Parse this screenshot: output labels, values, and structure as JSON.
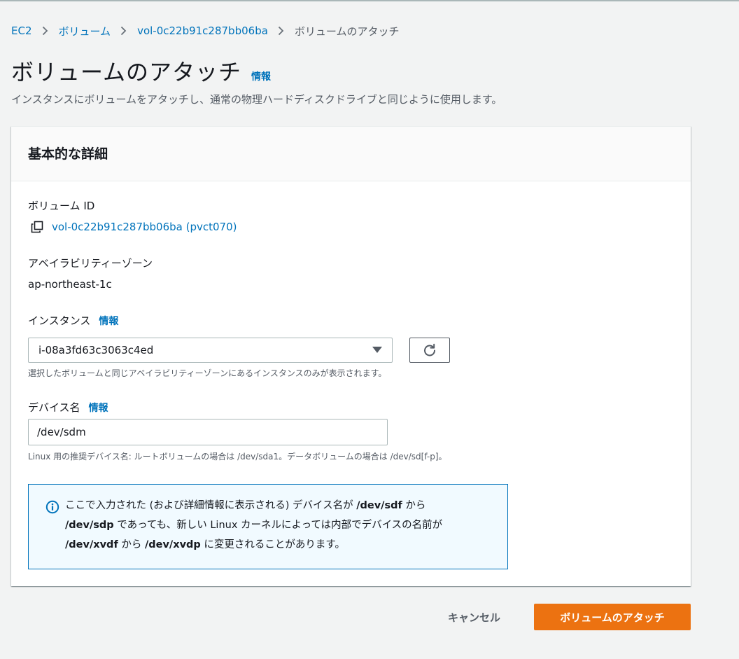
{
  "breadcrumb": {
    "items": [
      "EC2",
      "ボリューム",
      "vol-0c22b91c287bb06ba"
    ],
    "current": "ボリュームのアタッチ"
  },
  "header": {
    "title": "ボリュームのアタッチ",
    "info": "情報",
    "description": "インスタンスにボリュームをアタッチし、通常の物理ハードディスクドライブと同じように使用します。"
  },
  "card": {
    "title": "基本的な詳細",
    "volume_id": {
      "label": "ボリューム ID",
      "value": "vol-0c22b91c287bb06ba (pvct070)"
    },
    "availability_zone": {
      "label": "アベイラビリティーゾーン",
      "value": "ap-northeast-1c"
    },
    "instance": {
      "label": "インスタンス",
      "info": "情報",
      "selected": "i-08a3fd63c3063c4ed",
      "hint": "選択したボリュームと同じアベイラビリティーゾーンにあるインスタンスのみが表示されます。"
    },
    "device": {
      "label": "デバイス名",
      "info": "情報",
      "value": "/dev/sdm",
      "hint": "Linux 用の推奨デバイス名: ルートボリュームの場合は /dev/sda1。データボリュームの場合は /dev/sd[f-p]。"
    },
    "alert": {
      "t1": "ここで入力された (および詳細情報に表示される) デバイス名が ",
      "b1": "/dev/sdf",
      "t2": " から ",
      "b2": "/dev/sdp",
      "t3": " であっても、新しい Linux カーネルによっては内部でデバイスの名前が ",
      "b3": "/dev/xvdf",
      "t4": " から ",
      "b4": "/dev/xvdp",
      "t5": " に変更されることがあります。"
    }
  },
  "actions": {
    "cancel": "キャンセル",
    "attach": "ボリュームのアタッチ"
  },
  "colors": {
    "link": "#0073bb",
    "primary": "#ec7211",
    "alert_bg": "#f1faff",
    "alert_border": "#0073bb"
  }
}
